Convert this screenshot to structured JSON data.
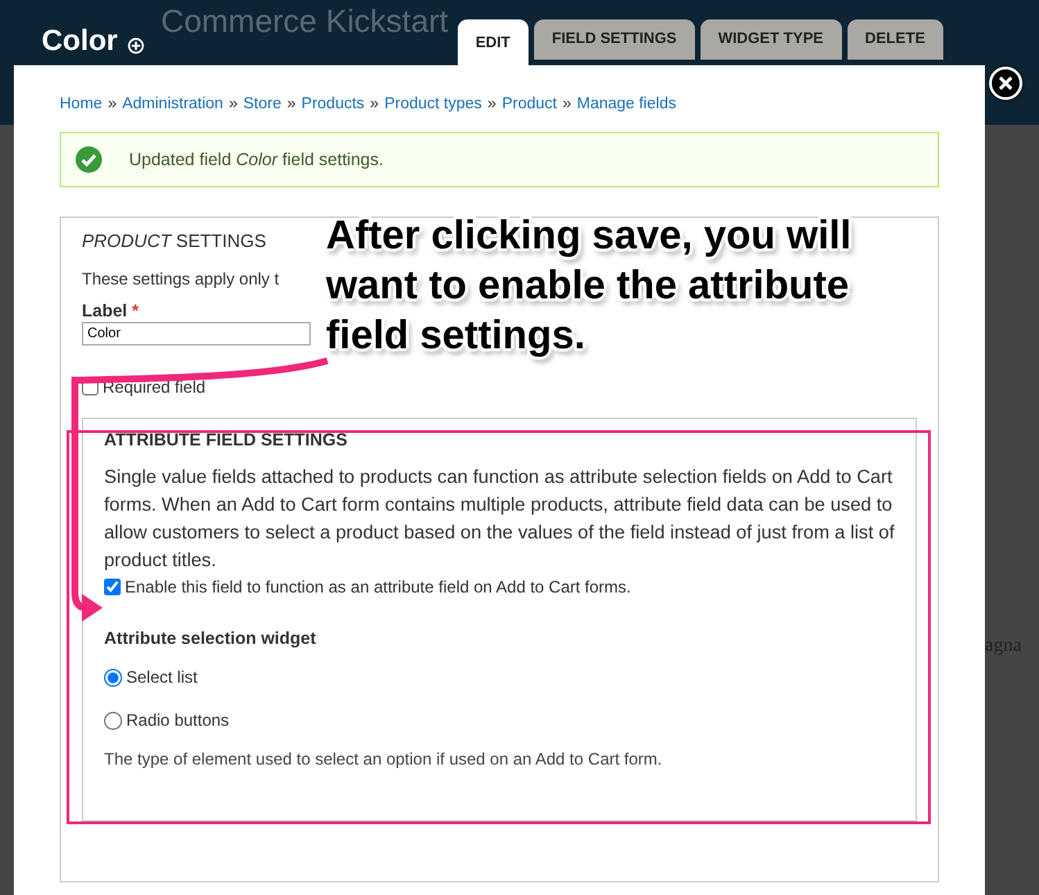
{
  "background": {
    "site_name": "Commerce Kickstart",
    "side_text": "agna"
  },
  "page_title": "Color",
  "tabs": [
    {
      "label": "EDIT",
      "selected": true
    },
    {
      "label": "FIELD SETTINGS",
      "selected": false
    },
    {
      "label": "WIDGET TYPE",
      "selected": false
    },
    {
      "label": "DELETE",
      "selected": false
    }
  ],
  "breadcrumbs": [
    "Home",
    "Administration",
    "Store",
    "Products",
    "Product types",
    "Product",
    "Manage fields"
  ],
  "breadcrumb_separator": "»",
  "message": {
    "text": "Updated field *Color* field settings."
  },
  "product_settings": {
    "title": "*PRODUCT* SETTINGS",
    "description": "These settings apply only t",
    "label": {
      "text": "Label",
      "required_mark": "*",
      "value": "Color"
    },
    "required": {
      "label": "Required field",
      "checked": false
    }
  },
  "attribute_settings": {
    "title": "ATTRIBUTE FIELD SETTINGS",
    "description": "Single value fields attached to products can function as attribute selection fields on Add to Cart forms. When an Add to Cart form contains multiple products, attribute field data can be used to allow customers to select a product based on the values of the field instead of just from a list of product titles.",
    "enable": {
      "label": "Enable this field to function as an attribute field on Add to Cart forms.",
      "checked": true
    },
    "widget_title": "Attribute selection widget",
    "options": [
      {
        "label": "Select list",
        "selected": true
      },
      {
        "label": "Radio buttons",
        "selected": false
      }
    ],
    "help": "The type of element used to select an option if used on an Add to Cart form."
  },
  "annotation": {
    "text": "After clicking save, you will want to enable the attribute field settings."
  }
}
